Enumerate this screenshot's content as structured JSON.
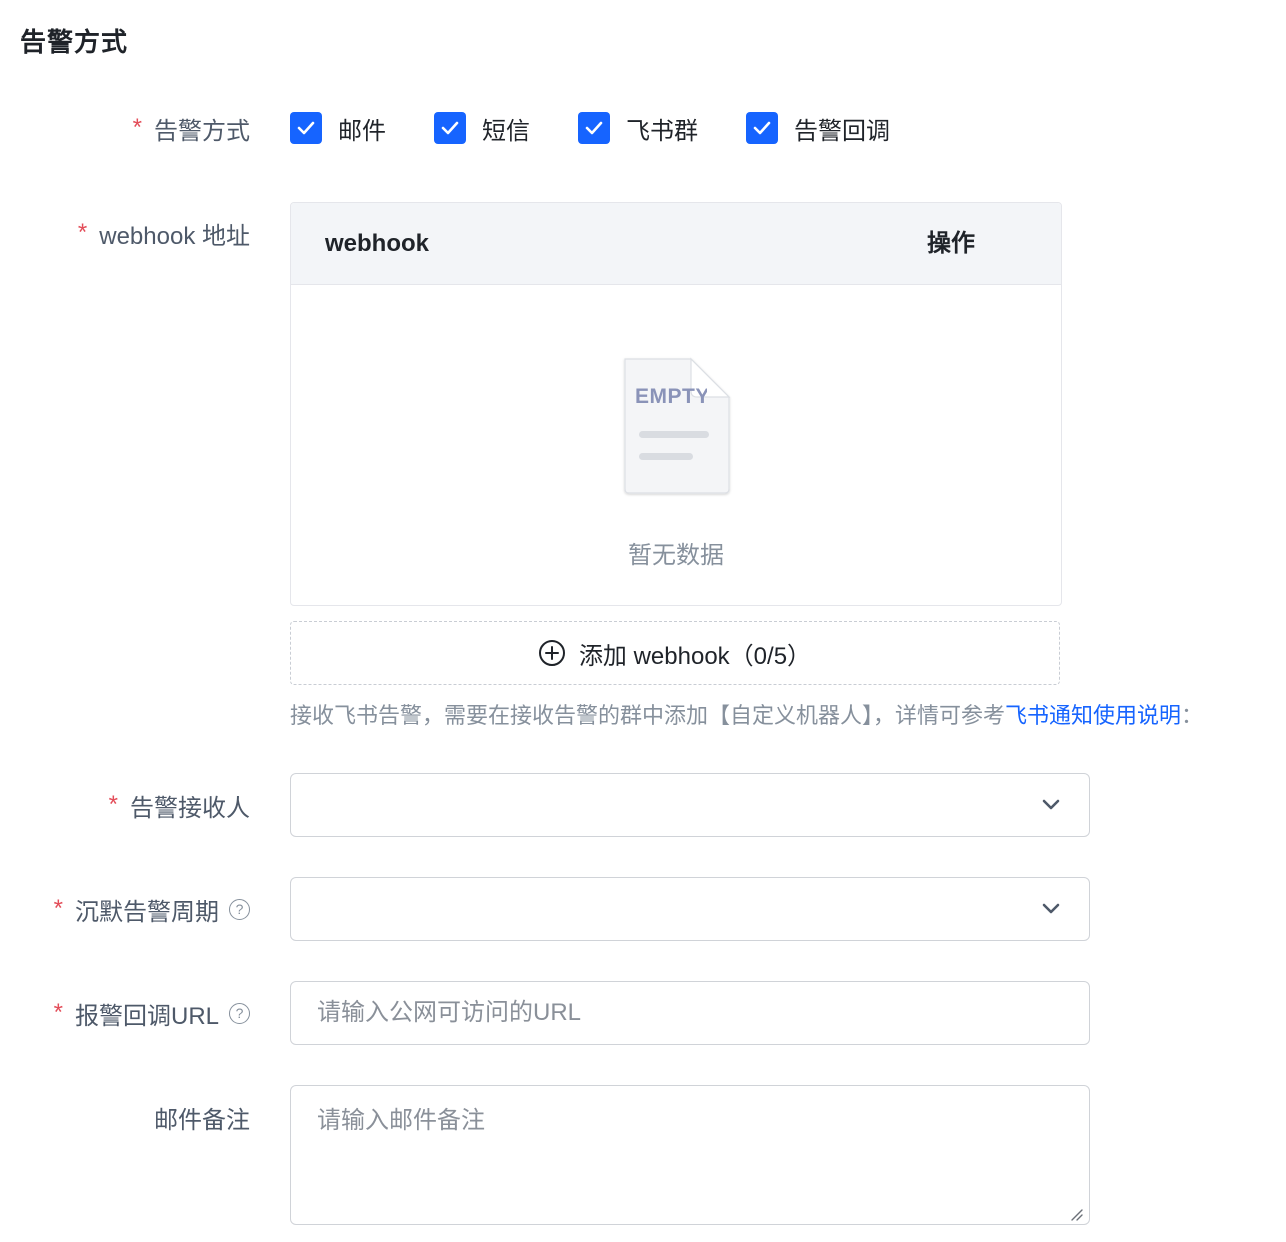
{
  "section_title": "告警方式",
  "alert_method": {
    "label": "告警方式",
    "options": [
      {
        "label": "邮件",
        "checked": true
      },
      {
        "label": "短信",
        "checked": true
      },
      {
        "label": "飞书群",
        "checked": true
      },
      {
        "label": "告警回调",
        "checked": true
      }
    ]
  },
  "webhook": {
    "label": "webhook 地址",
    "columns": [
      "webhook",
      "操作"
    ],
    "empty_icon_text": "EMPTY",
    "empty_text": "暂无数据",
    "add_button_label": "添加 webhook（0/5）",
    "hint_text": "接收飞书告警，需要在接收告警的群中添加【自定义机器人】，详情可参考",
    "hint_link": "飞书通知使用说明",
    "hint_trailing": "："
  },
  "receivers": {
    "label": "告警接收人",
    "value": ""
  },
  "silence_period": {
    "label": "沉默告警周期",
    "help_icon": "question-circle-icon",
    "value": ""
  },
  "callback_url": {
    "label": "报警回调URL",
    "help_icon": "question-circle-icon",
    "placeholder": "请输入公网可访问的URL"
  },
  "email_note": {
    "label": "邮件备注",
    "placeholder": "请输入邮件备注"
  },
  "colors": {
    "primary": "#1664ff",
    "required": "#e34d59",
    "muted": "#86909c"
  }
}
